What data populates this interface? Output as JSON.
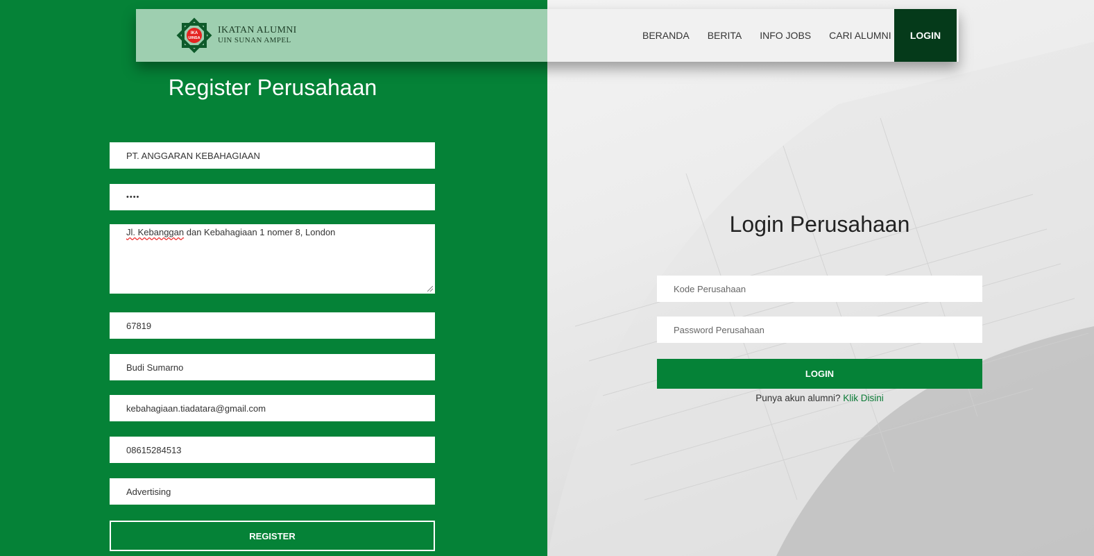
{
  "navbar": {
    "logo_line1": "IKATAN ALUMNI",
    "logo_line2": "UIN SUNAN AMPEL",
    "logo_badge": "IKA UINSA",
    "links": [
      "BERANDA",
      "BERITA",
      "INFO JOBS",
      "CARI ALUMNI"
    ],
    "login_label": "LOGIN"
  },
  "register": {
    "title": "Register Perusahaan",
    "company_name": "PT. ANGGARAN KEBAHAGIAAN",
    "password_mask": "••••",
    "address_part1": "Jl. Kebanggan",
    "address_part2": " dan Kebahagiaan 1 nomer 8, London",
    "postal_code": "67819",
    "contact_name": "Budi Sumarno",
    "email": "kebahagiaan.tiadatara@gmail.com",
    "phone": "08615284513",
    "industry": "Advertising",
    "button_label": "REGISTER"
  },
  "login": {
    "title": "Login Perusahaan",
    "code_placeholder": "Kode Perusahaan",
    "password_placeholder": "Password Perusahaan",
    "button_label": "LOGIN",
    "alumni_prompt": "Punya akun alumni? ",
    "alumni_link": "Klik Disini"
  },
  "colors": {
    "brand_green": "#058237",
    "dark_green": "#053a1a",
    "nav_light_green": "#9ecfb0"
  }
}
